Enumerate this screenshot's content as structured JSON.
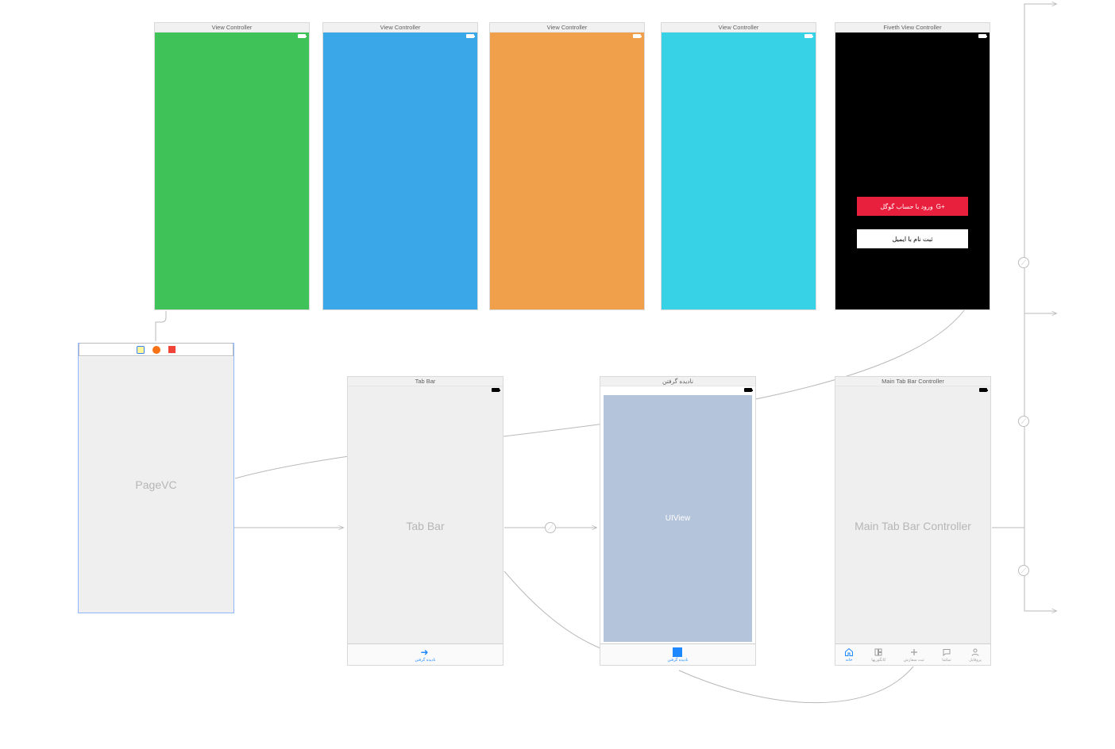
{
  "top_row": {
    "vc1": {
      "title": "View Controller",
      "bg": "#3fc257"
    },
    "vc2": {
      "title": "View Controller",
      "bg": "#3aa7e8"
    },
    "vc3": {
      "title": "View Controller",
      "bg": "#f0a04b"
    },
    "vc4": {
      "title": "View Controller",
      "bg": "#37d2e6"
    },
    "vc5": {
      "title": "Fiveth View Controller",
      "bg": "#000000",
      "google_label": "ورود با حساب گوگل",
      "google_badge": "G+",
      "email_label": "ثبت نام با ایمیل"
    }
  },
  "bottom_row": {
    "pagevc": {
      "label": "PageVC"
    },
    "tabbar_scene": {
      "title": "Tab Bar",
      "center": "Tab Bar",
      "tab_label": "نادیده گرفتن"
    },
    "ignore_scene": {
      "title": "نادیده گرفتن",
      "view_label": "UIView",
      "tab_label": "نادیده گرفتن"
    },
    "main_tab": {
      "title": "Main Tab Bar Controller",
      "center": "Main Tab Bar Controller",
      "tabs": [
        {
          "label": "خانه"
        },
        {
          "label": "کاتگوریها"
        },
        {
          "label": "ثبت سفارش"
        },
        {
          "label": "تماشا"
        },
        {
          "label": "پروفایل"
        }
      ]
    }
  }
}
